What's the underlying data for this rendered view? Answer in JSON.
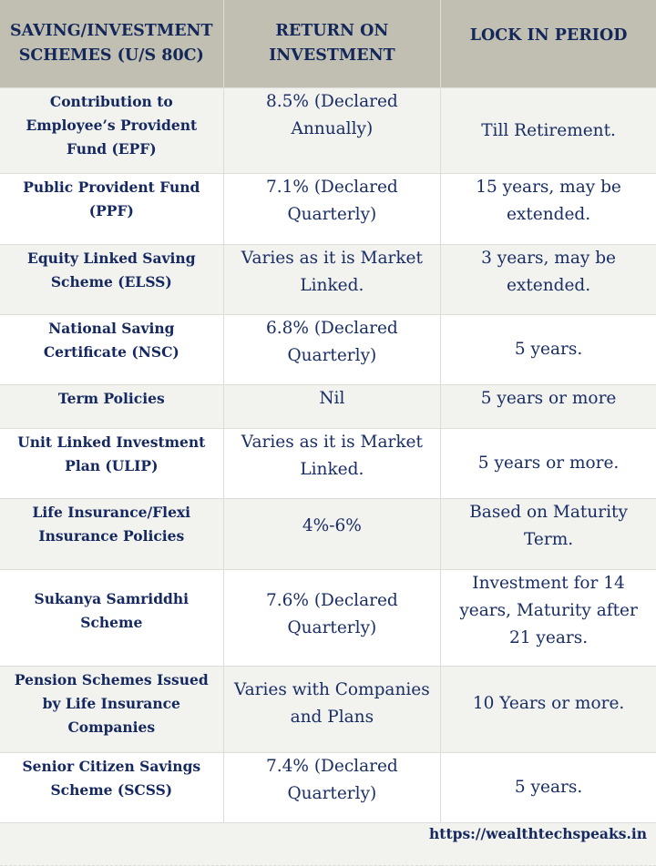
{
  "table": {
    "headers": {
      "scheme": "SAVING/INVESTMENT SCHEMES (U/S 80C)",
      "roi": "RETURN ON INVESTMENT",
      "lock": "LOCK IN PERIOD"
    },
    "rows": [
      {
        "scheme": "Contribution to Employee’s Provident Fund (EPF)",
        "roi": "8.5% (Declared Annually)",
        "lock": "Till Retirement."
      },
      {
        "scheme": "Public Provident Fund (PPF)",
        "roi": "7.1% (Declared Quarterly)",
        "lock": "15 years, may be extended."
      },
      {
        "scheme": "Equity Linked Saving Scheme (ELSS)",
        "roi": "Varies as it is Market Linked.",
        "lock": "3 years, may be extended."
      },
      {
        "scheme": "National Saving Certificate (NSC)",
        "roi": "6.8% (Declared Quarterly)",
        "lock": "5 years."
      },
      {
        "scheme": "Term Policies",
        "roi": "Nil",
        "lock": "5 years or more"
      },
      {
        "scheme": "Unit Linked Investment Plan (ULIP)",
        "roi": "Varies as it is Market Linked.",
        "lock": "5 years or more."
      },
      {
        "scheme": "Life Insurance/Flexi Insurance Policies",
        "roi": "4%-6%",
        "lock": "Based on Maturity Term."
      },
      {
        "scheme": "Sukanya Samriddhi Scheme",
        "roi": "7.6% (Declared Quarterly)",
        "lock": "Investment for 14 years, Maturity after 21 years."
      },
      {
        "scheme": "Pension Schemes Issued by Life Insurance Companies",
        "roi": "Varies with Companies and Plans",
        "lock": "10 Years or more."
      },
      {
        "scheme": "Senior Citizen Savings Scheme (SCSS)",
        "roi": "7.4% (Declared Quarterly)",
        "lock": "5 years."
      }
    ]
  },
  "footer": {
    "website": "https://wealthtechspeaks.in"
  },
  "colors": {
    "header_bg": "#c1bfb2",
    "row_alt_bg": "#f2f2ee",
    "row_bg": "#ffffff",
    "text": "#152960"
  }
}
